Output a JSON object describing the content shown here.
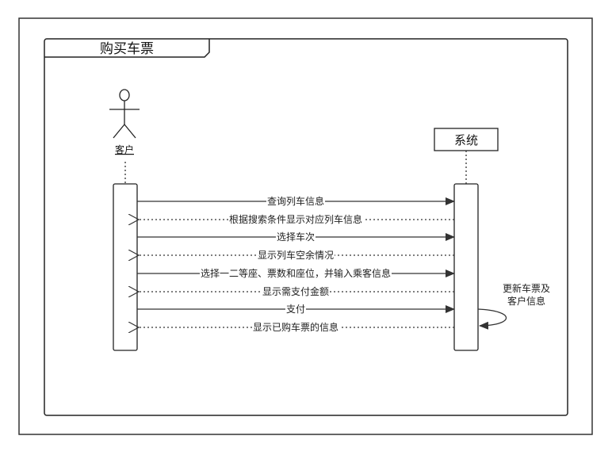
{
  "frame": {
    "title": "购买车票"
  },
  "actor": {
    "name": "客户"
  },
  "system": {
    "name": "系统"
  },
  "self_note": {
    "lines": [
      "更新车票及",
      "客户信息"
    ]
  },
  "messages": [
    {
      "label": "查询列车信息",
      "direction": "to-system",
      "kind": "call"
    },
    {
      "label": "根据搜索条件显示对应列车信息",
      "direction": "to-actor",
      "kind": "return"
    },
    {
      "label": "选择车次",
      "direction": "to-system",
      "kind": "call"
    },
    {
      "label": "显示列车空余情况",
      "direction": "to-actor",
      "kind": "return"
    },
    {
      "label": "选择一二等座、票数和座位，并输入乘客信息",
      "direction": "to-system",
      "kind": "call"
    },
    {
      "label": "显示需支付金额",
      "direction": "to-actor",
      "kind": "return"
    },
    {
      "label": "支付",
      "direction": "to-system",
      "kind": "call"
    },
    {
      "label": "显示已购车票的信息",
      "direction": "to-actor",
      "kind": "return"
    }
  ]
}
